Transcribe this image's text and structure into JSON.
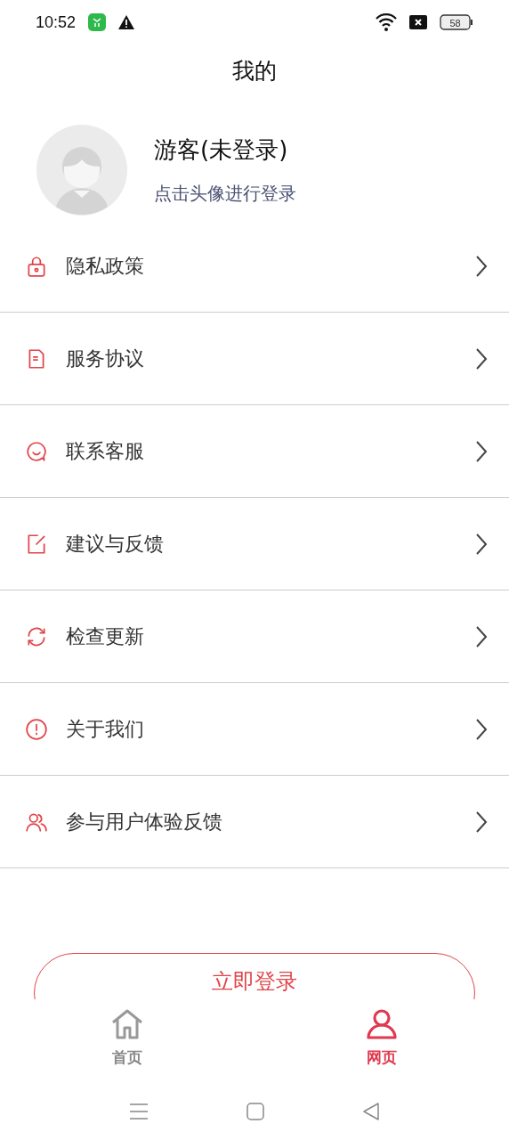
{
  "status_bar": {
    "time": "10:52",
    "battery": "58"
  },
  "title": "我的",
  "profile": {
    "name": "游客(未登录)",
    "hint": "点击头像进行登录"
  },
  "menu": [
    {
      "label": "隐私政策"
    },
    {
      "label": "服务协议"
    },
    {
      "label": "联系客服"
    },
    {
      "label": "建议与反馈"
    },
    {
      "label": "检查更新"
    },
    {
      "label": "关于我们"
    },
    {
      "label": "参与用户体验反馈"
    }
  ],
  "login_button": "立即登录",
  "tabs": [
    {
      "label": "首页",
      "selected": false
    },
    {
      "label": "网页",
      "selected": true
    }
  ]
}
